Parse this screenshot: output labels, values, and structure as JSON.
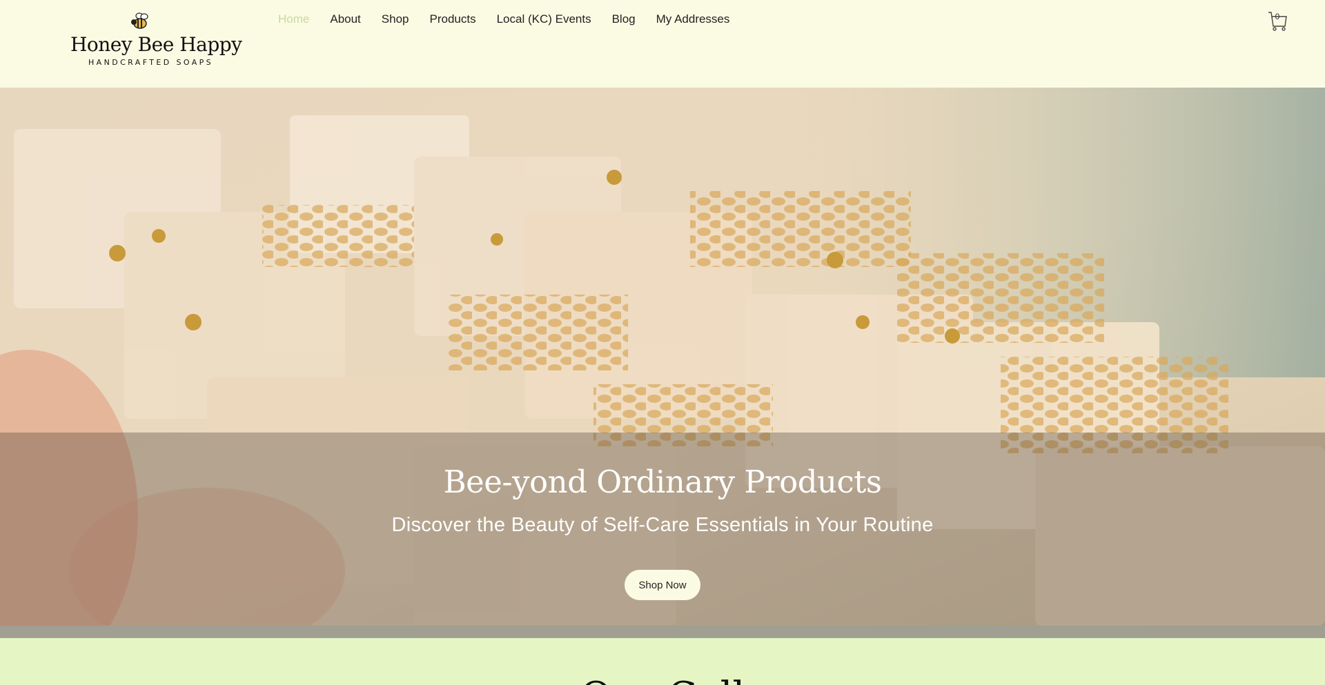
{
  "brand": {
    "name": "Honey Bee Happy",
    "tagline": "HANDCRAFTED SOAPS"
  },
  "nav": {
    "items": [
      {
        "label": "Home",
        "active": true
      },
      {
        "label": "About"
      },
      {
        "label": "Shop"
      },
      {
        "label": "Products"
      },
      {
        "label": "Local (KC) Events"
      },
      {
        "label": "Blog"
      },
      {
        "label": "My Addresses"
      }
    ]
  },
  "cart": {
    "count": "0",
    "icon": "cart-icon"
  },
  "hero": {
    "title": "Bee-yond Ordinary  Products",
    "subtitle": "Discover the Beauty of Self-Care Essentials in Your Routine",
    "cta_label": "Shop Now"
  },
  "section": {
    "title": "Our Coll"
  },
  "colors": {
    "header_bg": "#fbfbe4",
    "active_nav": "#c8d8a2",
    "section_bg": "#e5f6c4"
  }
}
